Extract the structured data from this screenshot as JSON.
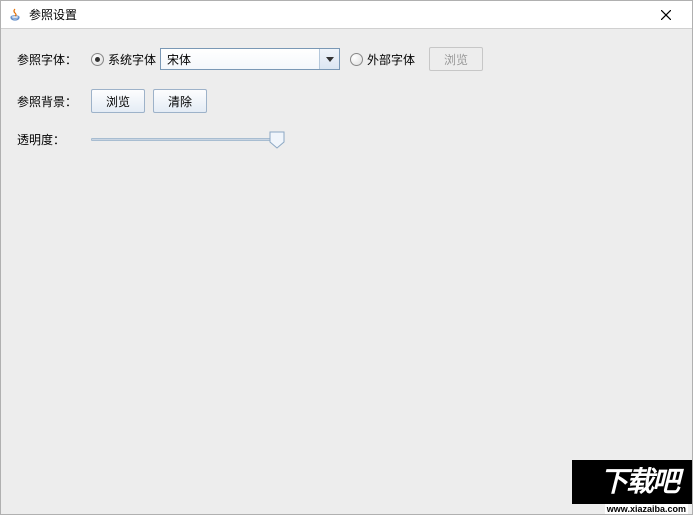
{
  "window": {
    "title": "参照设置"
  },
  "font": {
    "label": "参照字体：",
    "system_radio": "系统字体",
    "combo_value": "宋体",
    "external_radio": "外部字体",
    "browse_btn": "浏览"
  },
  "background": {
    "label": "参照背景：",
    "browse_btn": "浏览",
    "clear_btn": "清除"
  },
  "opacity": {
    "label": "透明度：",
    "value": 100
  },
  "watermark": {
    "text": "下载吧",
    "url": "www.xiazaiba.com"
  }
}
